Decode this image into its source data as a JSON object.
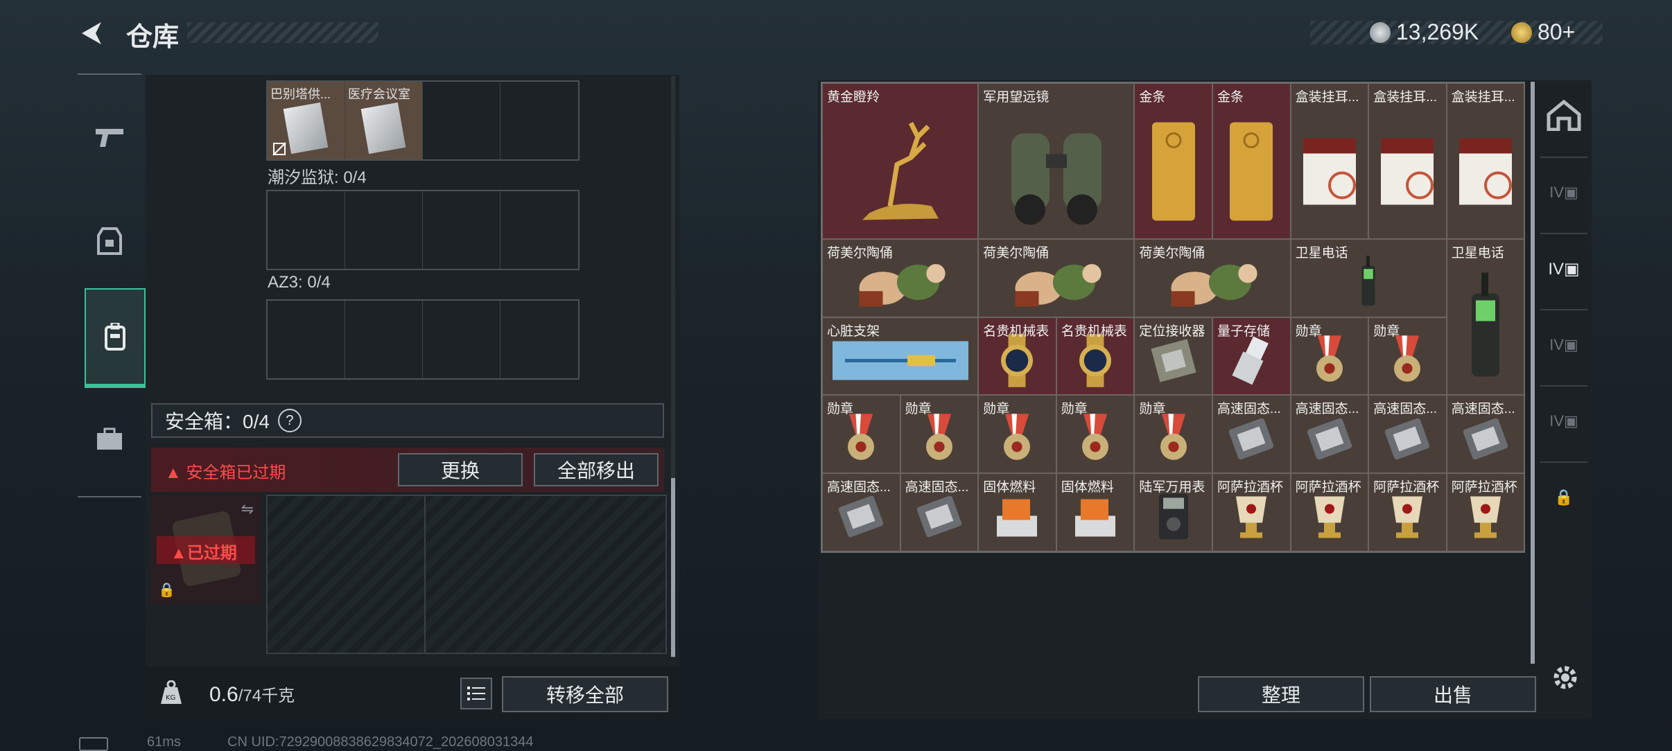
{
  "header": {
    "title": "仓库",
    "currency1": "13,269K",
    "currency2": "80+"
  },
  "left": {
    "top_items": [
      "巴别塔供...",
      "医疗会议室"
    ],
    "section1": "潮汐监狱: 0/4",
    "section2": "AZ3: 0/4",
    "safebox_label": "安全箱：0/4",
    "safebox_help": "?",
    "expired_msg": "安全箱已过期",
    "btn_replace": "更换",
    "btn_move_all": "全部移出",
    "case_expired": "已过期",
    "weight": "0.6",
    "weight_max": "/74千克",
    "btn_transfer_all": "转移全部"
  },
  "right": {
    "btn_sort": "整理",
    "btn_sell": "出售",
    "items": [
      {
        "name": "黄金瞪羚",
        "col": 0,
        "row": 0,
        "w": 2,
        "h": 2,
        "bg": "red",
        "icon": "deer-icon"
      },
      {
        "name": "军用望远镜",
        "col": 2,
        "row": 0,
        "w": 2,
        "h": 2,
        "bg": "brown",
        "icon": "binoculars-icon"
      },
      {
        "name": "金条",
        "col": 4,
        "row": 0,
        "w": 1,
        "h": 2,
        "bg": "red",
        "icon": "gold-bar-icon"
      },
      {
        "name": "金条",
        "col": 5,
        "row": 0,
        "w": 1,
        "h": 2,
        "bg": "red",
        "icon": "gold-bar-icon"
      },
      {
        "name": "盒装挂耳...",
        "col": 6,
        "row": 0,
        "w": 1,
        "h": 2,
        "bg": "brown",
        "icon": "coffee-box-icon"
      },
      {
        "name": "盒装挂耳...",
        "col": 7,
        "row": 0,
        "w": 1,
        "h": 2,
        "bg": "brown",
        "icon": "coffee-box-icon"
      },
      {
        "name": "盒装挂耳...",
        "col": 8,
        "row": 0,
        "w": 1,
        "h": 2,
        "bg": "brown",
        "icon": "coffee-box-icon"
      },
      {
        "name": "荷美尔陶俑",
        "col": 0,
        "row": 2,
        "w": 2,
        "h": 1,
        "bg": "brown",
        "icon": "figurine-icon"
      },
      {
        "name": "荷美尔陶俑",
        "col": 2,
        "row": 2,
        "w": 2,
        "h": 1,
        "bg": "brown",
        "icon": "figurine-icon"
      },
      {
        "name": "荷美尔陶俑",
        "col": 4,
        "row": 2,
        "w": 2,
        "h": 1,
        "bg": "brown",
        "icon": "figurine-icon"
      },
      {
        "name": "卫星电话",
        "col": 6,
        "row": 2,
        "w": 2,
        "h": 1,
        "bg": "brown",
        "icon": "sat-phone-icon"
      },
      {
        "name": "卫星电话",
        "col": 8,
        "row": 2,
        "w": 1,
        "h": 2,
        "bg": "brown",
        "icon": "sat-phone-icon"
      },
      {
        "name": "心脏支架",
        "col": 0,
        "row": 3,
        "w": 2,
        "h": 1,
        "bg": "brown",
        "icon": "stent-icon"
      },
      {
        "name": "名贵机械表",
        "col": 2,
        "row": 3,
        "w": 1,
        "h": 1,
        "bg": "red",
        "icon": "watch-icon"
      },
      {
        "name": "名贵机械表",
        "col": 3,
        "row": 3,
        "w": 1,
        "h": 1,
        "bg": "red",
        "icon": "watch-icon"
      },
      {
        "name": "定位接收器",
        "col": 4,
        "row": 3,
        "w": 1,
        "h": 1,
        "bg": "brown",
        "icon": "receiver-icon"
      },
      {
        "name": "量子存储",
        "col": 5,
        "row": 3,
        "w": 1,
        "h": 1,
        "bg": "red",
        "icon": "usb-icon"
      },
      {
        "name": "勋章",
        "col": 6,
        "row": 3,
        "w": 1,
        "h": 1,
        "bg": "brown",
        "icon": "medal-icon"
      },
      {
        "name": "勋章",
        "col": 7,
        "row": 3,
        "w": 1,
        "h": 1,
        "bg": "brown",
        "icon": "medal-icon"
      },
      {
        "name": "勋章",
        "col": 0,
        "row": 4,
        "w": 1,
        "h": 1,
        "bg": "brown",
        "icon": "medal-icon"
      },
      {
        "name": "勋章",
        "col": 1,
        "row": 4,
        "w": 1,
        "h": 1,
        "bg": "brown",
        "icon": "medal-icon"
      },
      {
        "name": "勋章",
        "col": 2,
        "row": 4,
        "w": 1,
        "h": 1,
        "bg": "brown",
        "icon": "medal-icon"
      },
      {
        "name": "勋章",
        "col": 3,
        "row": 4,
        "w": 1,
        "h": 1,
        "bg": "brown",
        "icon": "medal-icon"
      },
      {
        "name": "勋章",
        "col": 4,
        "row": 4,
        "w": 1,
        "h": 1,
        "bg": "brown",
        "icon": "medal-icon"
      },
      {
        "name": "高速固态...",
        "col": 5,
        "row": 4,
        "w": 1,
        "h": 1,
        "bg": "brown",
        "icon": "ssd-icon"
      },
      {
        "name": "高速固态...",
        "col": 6,
        "row": 4,
        "w": 1,
        "h": 1,
        "bg": "brown",
        "icon": "ssd-icon"
      },
      {
        "name": "高速固态...",
        "col": 7,
        "row": 4,
        "w": 1,
        "h": 1,
        "bg": "brown",
        "icon": "ssd-icon"
      },
      {
        "name": "高速固态...",
        "col": 8,
        "row": 4,
        "w": 1,
        "h": 1,
        "bg": "brown",
        "icon": "ssd-icon"
      },
      {
        "name": "高速固态...",
        "col": 0,
        "row": 5,
        "w": 1,
        "h": 1,
        "bg": "brown",
        "icon": "ssd-icon"
      },
      {
        "name": "高速固态...",
        "col": 1,
        "row": 5,
        "w": 1,
        "h": 1,
        "bg": "brown",
        "icon": "ssd-icon"
      },
      {
        "name": "固体燃料",
        "col": 2,
        "row": 5,
        "w": 1,
        "h": 1,
        "bg": "brown",
        "icon": "fuel-icon"
      },
      {
        "name": "固体燃料",
        "col": 3,
        "row": 5,
        "w": 1,
        "h": 1,
        "bg": "brown",
        "icon": "fuel-icon"
      },
      {
        "name": "陆军万用表",
        "col": 4,
        "row": 5,
        "w": 1,
        "h": 1,
        "bg": "brown",
        "icon": "multimeter-icon"
      },
      {
        "name": "阿萨拉酒杯",
        "col": 5,
        "row": 5,
        "w": 1,
        "h": 1,
        "bg": "brown",
        "icon": "cup-icon"
      },
      {
        "name": "阿萨拉酒杯",
        "col": 6,
        "row": 5,
        "w": 1,
        "h": 1,
        "bg": "brown",
        "icon": "cup-icon"
      },
      {
        "name": "阿萨拉酒杯",
        "col": 7,
        "row": 5,
        "w": 1,
        "h": 1,
        "bg": "brown",
        "icon": "cup-icon"
      },
      {
        "name": "阿萨拉酒杯",
        "col": 8,
        "row": 5,
        "w": 1,
        "h": 1,
        "bg": "brown",
        "icon": "cup-icon"
      }
    ]
  },
  "status": {
    "ping": "61ms",
    "uid": "CN UID:72929008838629834072_202608031344"
  },
  "colors": {
    "accent": "#3ac29a",
    "warn": "#ff4a4a",
    "red_cell": "#5a2a30",
    "brown_cell": "#4a3f38"
  }
}
